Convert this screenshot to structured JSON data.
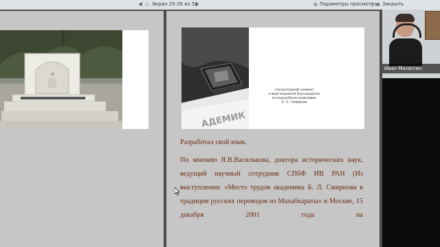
{
  "toolbar": {
    "page_indicator": "Экран 25-26 из 52",
    "view_params": "Параметры просмотра",
    "close": "Закрыть"
  },
  "slide_right": {
    "caption_lines": [
      "Скульптурный элемент",
      "в виде изданной Бхагавадгиты",
      "на надгробном памятнике",
      "Б. Л. Смирнова"
    ],
    "paragraph1": "Разработал свой язык.",
    "paragraph2": "По мнению Я.В.Василькова, доктора исторических наук, ведущий научный сотрудник СПбФ ИВ РАН (Из выступления: «Место трудов академика Б. Л. Смирнова в традиции русских переводов из Махабхараты» в Москве, 15 декабря 2001 года на"
  },
  "video": {
    "participant_name": "Иван Малютин"
  },
  "colors": {
    "slide_text": "#6b2a0e",
    "page_bg": "#c6c6c6",
    "toolbar_bg": "#dfe3e8"
  }
}
